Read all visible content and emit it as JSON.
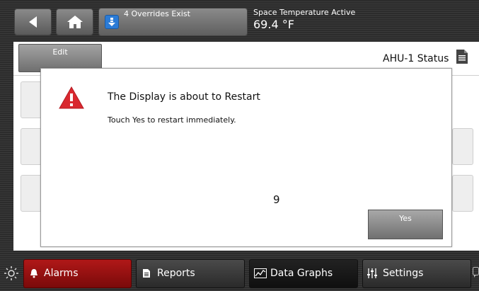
{
  "header": {
    "overrides_label": "4 Overrides Exist",
    "temperature_label": "Space Temperature Active",
    "temperature_value": "69.4 °F"
  },
  "toolbar": {
    "edit_label": "Edit",
    "status_title": "AHU-1 Status"
  },
  "dialog": {
    "title": "The Display is about to Restart",
    "message": "Touch Yes to restart immediately.",
    "countdown": "9",
    "yes_label": "Yes"
  },
  "nav": {
    "alarms": "Alarms",
    "reports": "Reports",
    "data_graphs": "Data Graphs",
    "settings": "Settings"
  },
  "colors": {
    "alarm_tab": "#a01212",
    "warning_icon": "#d9282f",
    "override_icon": "#2b7bd6"
  },
  "icons": [
    "back-arrow-icon",
    "home-icon",
    "override-download-icon",
    "document-icon",
    "warning-icon",
    "brightness-icon",
    "bell-icon",
    "reports-icon",
    "chart-icon",
    "sliders-icon",
    "chat-icon"
  ]
}
